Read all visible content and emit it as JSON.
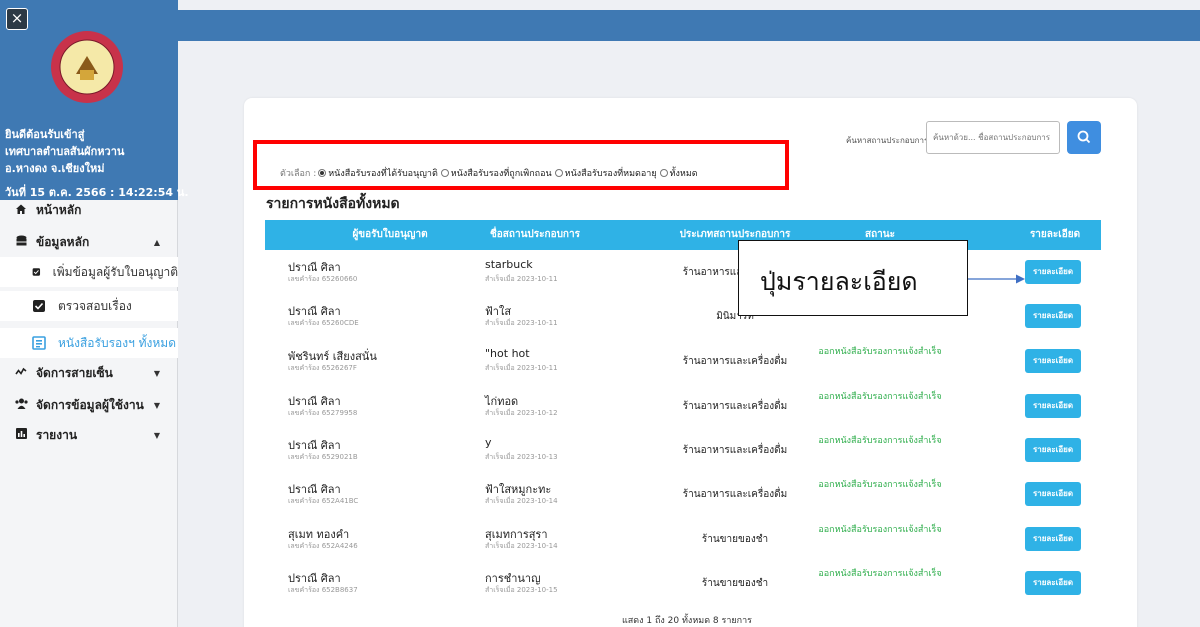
{
  "sidebar": {
    "welcome_lines": [
      "ยินดีต้อนรับเข้าสู่",
      "เทศบาลตำบลสันผักหวาน",
      "อ.หางดง จ.เชียงใหม่"
    ],
    "datetime": "วันที่ 15 ต.ค. 2566 : 14:22:54 น.",
    "close_glyph": "×",
    "items": [
      {
        "label": "หน้าหลัก",
        "icon": "home-icon"
      },
      {
        "label": "ข้อมูลหลัก",
        "icon": "database-icon"
      },
      {
        "label": "จัดการสายเซ็น",
        "icon": "signature-icon"
      },
      {
        "label": "จัดการข้อมูลผู้ใช้งาน",
        "icon": "users-icon"
      },
      {
        "label": "รายงาน",
        "icon": "chart-icon"
      }
    ],
    "subitems": [
      {
        "label": "เพิ่มข้อมูลผู้รับใบอนุญาติ",
        "icon": "check-square-icon"
      },
      {
        "label": "ตรวจสอบเรื่อง",
        "icon": "check-square-icon"
      },
      {
        "label": "หนังสือรับรองฯ ทั้งหมด",
        "icon": "document-icon"
      }
    ]
  },
  "filter": {
    "label": "ตัวเลือก :",
    "options": [
      {
        "label": "หนังสือรับรองที่ได้รับอนุญาติ",
        "selected": true
      },
      {
        "label": "หนังสือรับรองที่ถูกเพิกถอน",
        "selected": false
      },
      {
        "label": "หนังสือรับรองที่หมดอายุ",
        "selected": false
      },
      {
        "label": "ทั้งหมด",
        "selected": false
      }
    ]
  },
  "search": {
    "label": "ค้นหาสถานประกอบการ",
    "placeholder": "ค้นหาด้วย... ชื่อสถานประกอบการ"
  },
  "list_title": "รายการหนังสือทั้งหมด",
  "table": {
    "headers": [
      "ผู้ขอรับใบอนุญาต",
      "ชื่อสถานประกอบการ",
      "ประเภทสถานประกอบการ",
      "สถานะ",
      "รายละเอียด"
    ],
    "rows": [
      {
        "name": "ปราณี ศิลา",
        "ref": "เลขคำร้อง 65260660",
        "shop": "starbuck",
        "date": "สำเร็จเมื่อ 2023-10-11",
        "type": "ร้านอาหารและเครื่องดื่ม",
        "status": "ออกหนังสือรับรองการแจ้งสำเร็จ",
        "btn": "รายละเอียด"
      },
      {
        "name": "ปราณี ศิลา",
        "ref": "เลขคำร้อง 65260CDE",
        "shop": "ฟ้าใส",
        "date": "สำเร็จเมื่อ 2023-10-11",
        "type": "มินิมาร์ท",
        "status": "ออกหนังสือรับรองการแจ้งสำเร็จ",
        "btn": "รายละเอียด"
      },
      {
        "name": "พัชรินทร์ เสียงสนั่น",
        "ref": "เลขคำร้อง 6526267F",
        "shop": "\"hot hot",
        "date": "สำเร็จเมื่อ 2023-10-11",
        "type": "ร้านอาหารและเครื่องดื่ม",
        "status": "ออกหนังสือรับรองการแจ้งสำเร็จ",
        "btn": "รายละเอียด"
      },
      {
        "name": "ปราณี ศิลา",
        "ref": "เลขคำร้อง 65279958",
        "shop": "ไก่ทอด",
        "date": "สำเร็จเมื่อ 2023-10-12",
        "type": "ร้านอาหารและเครื่องดื่ม",
        "status": "ออกหนังสือรับรองการแจ้งสำเร็จ",
        "btn": "รายละเอียด"
      },
      {
        "name": "ปราณี ศิลา",
        "ref": "เลขคำร้อง 6529021B",
        "shop": "y",
        "date": "สำเร็จเมื่อ 2023-10-13",
        "type": "ร้านอาหารและเครื่องดื่ม",
        "status": "ออกหนังสือรับรองการแจ้งสำเร็จ",
        "btn": "รายละเอียด"
      },
      {
        "name": "ปราณี ศิลา",
        "ref": "เลขคำร้อง 652A41BC",
        "shop": "ฟ้าใสหมูกะทะ",
        "date": "สำเร็จเมื่อ 2023-10-14",
        "type": "ร้านอาหารและเครื่องดื่ม",
        "status": "ออกหนังสือรับรองการแจ้งสำเร็จ",
        "btn": "รายละเอียด"
      },
      {
        "name": "สุเมท ทองคำ",
        "ref": "เลขคำร้อง 652A4246",
        "shop": "สุเมทการสุรา",
        "date": "สำเร็จเมื่อ 2023-10-14",
        "type": "ร้านขายของชำ",
        "status": "ออกหนังสือรับรองการแจ้งสำเร็จ",
        "btn": "รายละเอียด"
      },
      {
        "name": "ปราณี ศิลา",
        "ref": "เลขคำร้อง 652B8637",
        "shop": "การชำนาญ",
        "date": "สำเร็จเมื่อ 2023-10-15",
        "type": "ร้านขายของชำ",
        "status": "ออกหนังสือรับรองการแจ้งสำเร็จ",
        "btn": "รายละเอียด"
      }
    ]
  },
  "footer": {
    "info": "แสดง 1 ถึง 20 ทั้งหมด 8 รายการ"
  },
  "annotation": {
    "text": "ปุ่มรายละเอียด"
  },
  "colors": {
    "primary": "#3f79b3",
    "header": "#2fb2e6",
    "status": "#2fae4c",
    "highlight": "#ff0000"
  }
}
